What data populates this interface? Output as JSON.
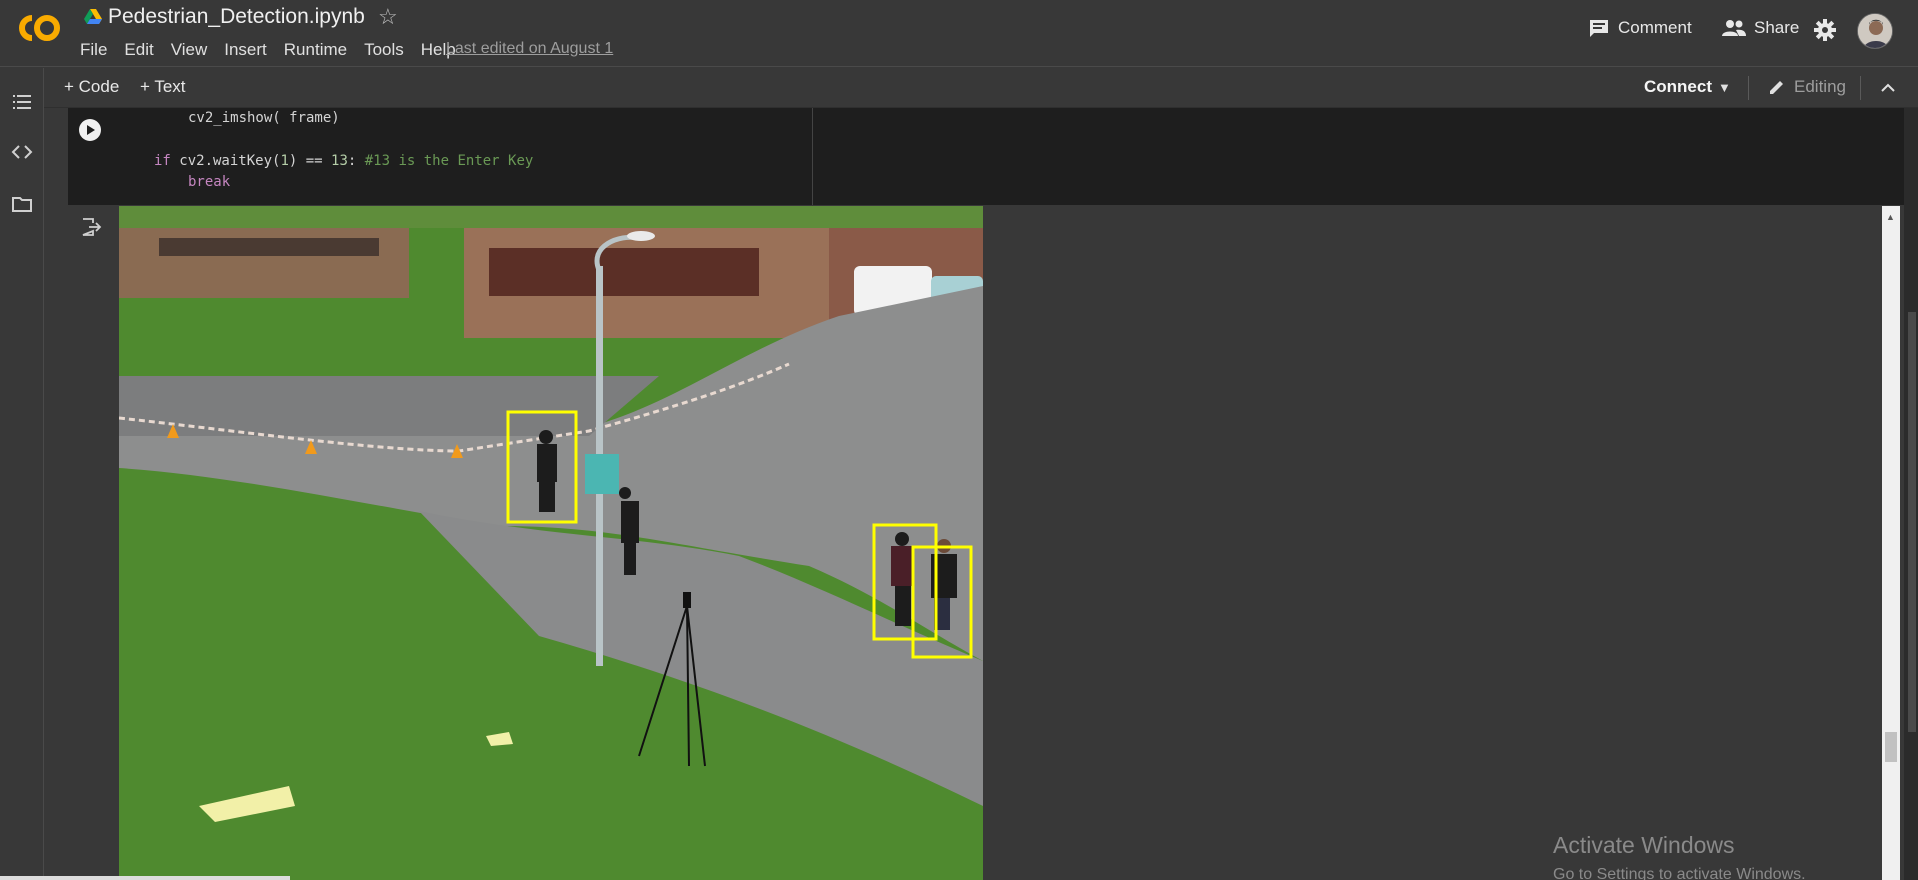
{
  "header": {
    "logo_text": "CO",
    "title": "Pedestrian_Detection.ipynb",
    "menu": [
      "File",
      "Edit",
      "View",
      "Insert",
      "Runtime",
      "Tools",
      "Help"
    ],
    "last_edited": "Last edited on August 1",
    "comment_label": "Comment",
    "share_label": "Share"
  },
  "toolbar": {
    "code_label": "+ Code",
    "text_label": "+ Text",
    "connect_label": "Connect",
    "editing_label": "Editing"
  },
  "code": {
    "line1": "cv2_imshow( frame)",
    "line2_kw": "if",
    "line2_mid": " cv2.waitKey(",
    "line2_num1": "1",
    "line2_mid2": ") == ",
    "line2_num2": "13",
    "line2_colon": ": ",
    "line2_comment": "#13 is the Enter Key",
    "line3": "break"
  },
  "watermark": {
    "title": "Activate Windows",
    "subtitle": "Go to Settings to activate Windows."
  },
  "colors": {
    "background": "#383838",
    "cell": "#1e1e1e",
    "logo_orange": "#f9ab00",
    "detection_box": "#ffff00",
    "keyword": "#c586c0",
    "number": "#b5cea8",
    "comment": "#6a9955"
  },
  "icons": [
    "colab-logo",
    "drive-icon",
    "star-icon",
    "comment-icon",
    "share-icon",
    "gear-icon",
    "avatar",
    "table-of-contents-icon",
    "code-snippets-icon",
    "files-icon",
    "run-cell-icon",
    "pencil-icon",
    "collapse-icon",
    "output-icon"
  ]
}
